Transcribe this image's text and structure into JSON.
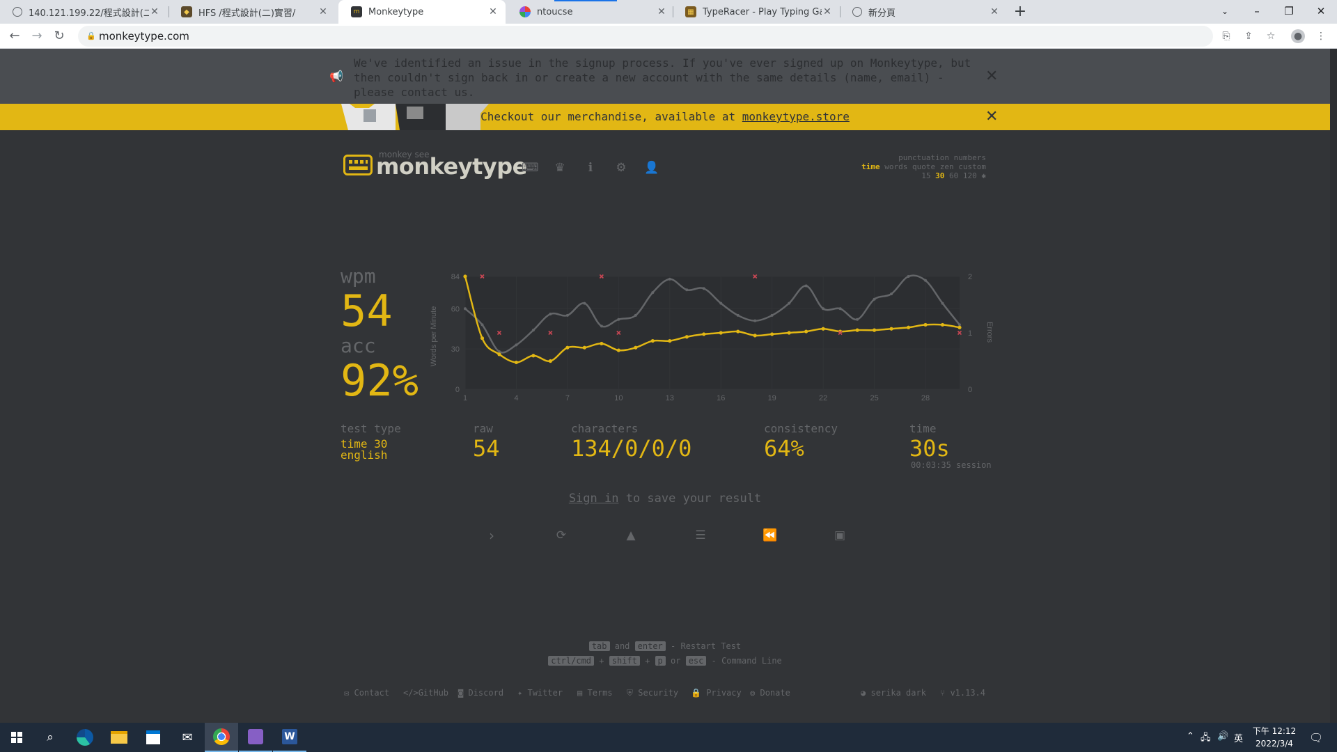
{
  "browser": {
    "tabs": [
      {
        "title": "140.121.199.22/程式設計(二)實習",
        "icon": "globe-icon",
        "active": false
      },
      {
        "title": "HFS /程式設計(二)實習/",
        "icon": "hfs-icon",
        "active": false
      },
      {
        "title": "Monkeytype",
        "icon": "monkeytype-icon",
        "active": true
      },
      {
        "title": "ntoucse",
        "icon": "ntoucse-icon",
        "active": false
      },
      {
        "title": "TypeRacer - Play Typing Games",
        "icon": "typeracer-icon",
        "active": false
      },
      {
        "title": "新分頁",
        "icon": "globe-icon",
        "active": false
      }
    ],
    "url": "monkeytype.com"
  },
  "banners": {
    "notice": "We've identified an issue in the signup process. If you've ever signed up on Monkeytype, but then couldn't sign back in or create a new account with the same details (name, email) - please contact us.",
    "merch_text": "Checkout our merchandise, available at",
    "merch_link": "monkeytype.store"
  },
  "header": {
    "tagline": "monkey see",
    "logo": "monkeytype",
    "config": {
      "row1": "punctuation numbers",
      "row2_active": "time",
      "row2_rest": "words quote zen custom",
      "row3_pre": "15",
      "row3_active": "30",
      "row3_post": "60 120"
    }
  },
  "result": {
    "wpm_label": "wpm",
    "wpm": "54",
    "acc_label": "acc",
    "acc": "92%",
    "stats": {
      "test_type_label": "test type",
      "test_type_line1": "time 30",
      "test_type_line2": "english",
      "raw_label": "raw",
      "raw": "54",
      "characters_label": "characters",
      "characters": "134/0/0/0",
      "consistency_label": "consistency",
      "consistency": "64%",
      "time_label": "time",
      "time": "30s",
      "session": "00:03:35 session"
    },
    "signin_link": "Sign in",
    "signin_rest": " to save your result"
  },
  "chart_data": {
    "type": "line",
    "x": [
      1,
      2,
      3,
      4,
      5,
      6,
      7,
      8,
      9,
      10,
      11,
      12,
      13,
      14,
      15,
      16,
      17,
      18,
      19,
      20,
      21,
      22,
      23,
      24,
      25,
      26,
      27,
      28,
      29,
      30
    ],
    "series": [
      {
        "name": "wpm",
        "values": [
          84,
          38,
          26,
          20,
          25,
          21,
          31,
          31,
          34,
          29,
          31,
          36,
          36,
          39,
          41,
          42,
          43,
          40,
          41,
          42,
          43,
          45,
          43,
          44,
          44,
          45,
          46,
          48,
          48,
          46
        ]
      },
      {
        "name": "raw",
        "values": [
          60,
          48,
          28,
          33,
          44,
          56,
          55,
          64,
          47,
          52,
          55,
          72,
          82,
          74,
          75,
          64,
          55,
          51,
          55,
          64,
          77,
          60,
          60,
          52,
          67,
          71,
          84,
          81,
          64,
          48
        ]
      },
      {
        "name": "errors",
        "values": [
          null,
          2,
          1,
          null,
          null,
          1,
          null,
          null,
          2,
          1,
          null,
          null,
          null,
          null,
          null,
          null,
          null,
          2,
          null,
          null,
          null,
          null,
          1,
          null,
          null,
          null,
          null,
          null,
          null,
          1
        ]
      }
    ],
    "xlabel": "",
    "ylabel": "Words per Minute",
    "y2label": "Errors",
    "ylim": [
      0,
      84
    ],
    "y2lim": [
      0,
      2
    ],
    "yticks": [
      "84",
      "60",
      "30",
      "0"
    ],
    "y2ticks": [
      "2",
      "1",
      "0"
    ],
    "xticks": [
      "1",
      "4",
      "7",
      "10",
      "13",
      "16",
      "19",
      "22",
      "25",
      "28"
    ],
    "colors": {
      "wpm": "#e2b714",
      "raw": "#646669",
      "errors": "#ca4754"
    }
  },
  "actions": [
    {
      "name": "next-test-button",
      "icon": "chevron-right-icon"
    },
    {
      "name": "repeat-test-button",
      "icon": "sync-icon"
    },
    {
      "name": "practice-words-button",
      "icon": "warning-icon"
    },
    {
      "name": "words-history-button",
      "icon": "align-left-icon"
    },
    {
      "name": "replay-button",
      "icon": "backward-icon"
    },
    {
      "name": "screenshot-button",
      "icon": "image-icon"
    }
  ],
  "footer": {
    "hint1": {
      "k1": "tab",
      "mid": "and",
      "k2": "enter",
      "rest": "- Restart Test"
    },
    "hint2": {
      "k1": "ctrl/cmd",
      "p1": "+",
      "k2": "shift",
      "p2": "+",
      "k3": "p",
      "p3": "or",
      "k4": "esc",
      "rest": "- Command Line"
    },
    "links": [
      "Contact",
      "GitHub",
      "Discord",
      "Twitter",
      "Terms",
      "Security",
      "Privacy",
      "Donate"
    ],
    "theme": "serika dark",
    "version": "v1.13.4"
  },
  "taskbar": {
    "ime": "英",
    "time": "下午 12:12",
    "date": "2022/3/4"
  },
  "colors": {
    "accent": "#e2b714",
    "background": "#323437",
    "sub": "#646669",
    "text": "#d1d0c5",
    "error": "#ca4754"
  }
}
